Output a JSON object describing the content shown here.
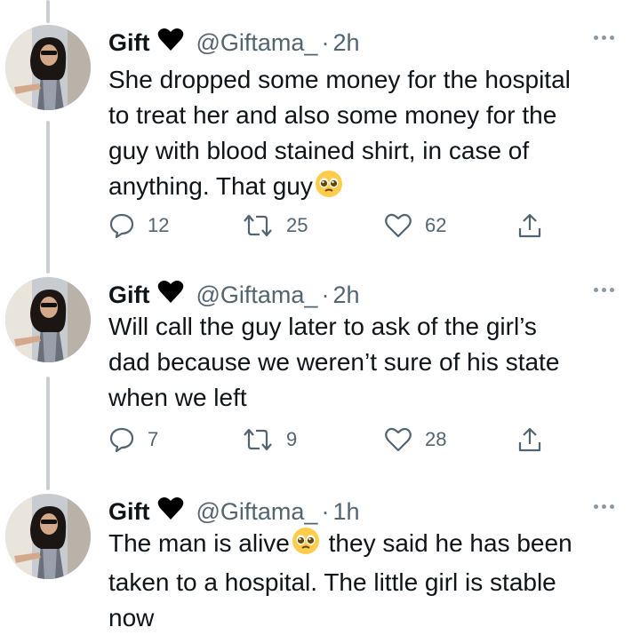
{
  "tweets": [
    {
      "name": "Gift",
      "handle": "@Giftama_",
      "dot": "·",
      "time": "2h",
      "text_lines": [
        "She dropped some money for the hospital",
        "to treat her and also some money for the",
        "guy with blood stained shirt, in case of",
        "anything. That guy"
      ],
      "stats": {
        "replies": "12",
        "retweets": "25",
        "likes": "62"
      }
    },
    {
      "name": "Gift",
      "handle": "@Giftama_",
      "dot": "·",
      "time": "2h",
      "text_lines": [
        "Will call the guy later to ask of the girl’s",
        "dad because we weren’t sure of his state",
        "when we left"
      ],
      "stats": {
        "replies": "7",
        "retweets": "9",
        "likes": "28"
      }
    },
    {
      "name": "Gift",
      "handle": "@Giftama_",
      "dot": "·",
      "time": "1h",
      "text_lines": [
        "The man is alive",
        " they said he has been",
        "taken to a hospital. The little girl is stable",
        "now"
      ]
    }
  ],
  "icons": {
    "reply": "reply-icon",
    "retweet": "retweet-icon",
    "like": "like-icon",
    "share": "share-icon",
    "heart": "black-heart-icon",
    "emoji": "pleading-face-emoji",
    "more": "more-options-icon"
  },
  "colors": {
    "text": "#0f1419",
    "secondary": "#536471",
    "thread_line": "#c9cfd4"
  }
}
